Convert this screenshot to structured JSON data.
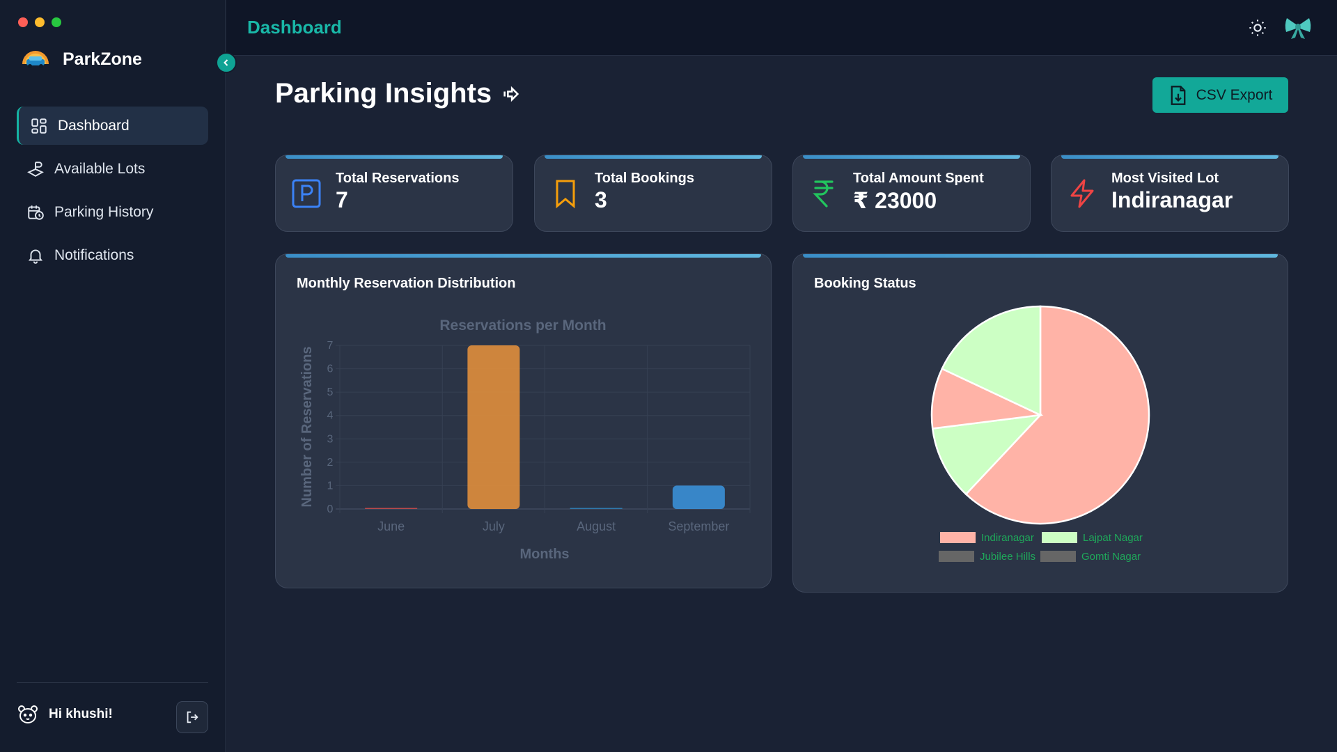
{
  "app": {
    "brand_name": "ParkZone",
    "traffic_colors": [
      "#ff5f57",
      "#febc2e",
      "#28c840"
    ]
  },
  "sidebar": {
    "items": [
      {
        "label": "Dashboard",
        "icon": "dashboard-grid-icon",
        "active": true
      },
      {
        "label": "Available Lots",
        "icon": "parking-lot-icon",
        "active": false
      },
      {
        "label": "Parking History",
        "icon": "calendar-clock-icon",
        "active": false
      },
      {
        "label": "Notifications",
        "icon": "bell-icon",
        "active": false
      }
    ],
    "user_greeting": "Hi khushi!"
  },
  "topbar": {
    "title": "Dashboard",
    "theme_icon": "sun-icon",
    "profile_icon": "bow-icon"
  },
  "main": {
    "title": "Parking Insights",
    "export_label": "CSV Export"
  },
  "stats": [
    {
      "label": "Total Reservations",
      "value": "7",
      "icon": "parking-icon",
      "color": "#3b82f6"
    },
    {
      "label": "Total Bookings",
      "value": "3",
      "icon": "bookmark-icon",
      "color": "#f59e0b"
    },
    {
      "label": "Total Amount Spent",
      "value": "₹ 23000",
      "icon": "rupee-icon",
      "color": "#22c55e"
    },
    {
      "label": "Most Visited Lot",
      "value": "Indiranagar",
      "icon": "lightning-icon",
      "color": "#ef4444"
    }
  ],
  "panels": {
    "monthly_title": "Monthly Reservation Distribution",
    "booking_title": "Booking Status"
  },
  "chart_data": [
    {
      "type": "bar",
      "title": "Reservations per Month",
      "xlabel": "Months",
      "ylabel": "Number of Reservations",
      "categories": [
        "June",
        "July",
        "August",
        "September"
      ],
      "values": [
        0,
        7,
        0,
        1
      ],
      "colors": [
        "#c94a4a",
        "#e08e3c",
        "#2f7fb8",
        "#3a8fd6"
      ],
      "ylim": [
        0,
        7
      ],
      "yticks": [
        "0",
        "1",
        "2",
        "3",
        "4",
        "5",
        "6",
        "7"
      ],
      "grid": true
    },
    {
      "type": "pie",
      "labels": [
        "Indiranagar",
        "Lajpat Nagar",
        "Jubilee Hills",
        "Gomti Nagar"
      ],
      "slice_order": [
        "Indiranagar",
        "Lajpat Nagar",
        "Indiranagar",
        "Lajpat Nagar"
      ],
      "values": [
        62,
        11,
        9,
        18
      ],
      "slice_colors": [
        "#ffb3a7",
        "#ccffc4",
        "#ffb3a7",
        "#ccffc4"
      ],
      "legend_colors": [
        "#ffb3a7",
        "#ccffc4",
        "#666666",
        "#666666"
      ],
      "legend_position": "bottom"
    }
  ]
}
